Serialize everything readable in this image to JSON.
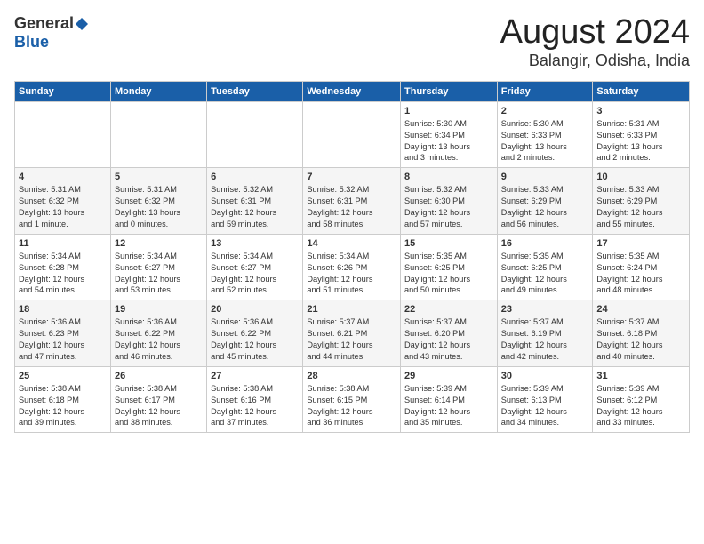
{
  "logo": {
    "general": "General",
    "blue": "Blue"
  },
  "title": "August 2024",
  "location": "Balangir, Odisha, India",
  "days_of_week": [
    "Sunday",
    "Monday",
    "Tuesday",
    "Wednesday",
    "Thursday",
    "Friday",
    "Saturday"
  ],
  "weeks": [
    [
      {
        "day": "",
        "content": ""
      },
      {
        "day": "",
        "content": ""
      },
      {
        "day": "",
        "content": ""
      },
      {
        "day": "",
        "content": ""
      },
      {
        "day": "1",
        "content": "Sunrise: 5:30 AM\nSunset: 6:34 PM\nDaylight: 13 hours\nand 3 minutes."
      },
      {
        "day": "2",
        "content": "Sunrise: 5:30 AM\nSunset: 6:33 PM\nDaylight: 13 hours\nand 2 minutes."
      },
      {
        "day": "3",
        "content": "Sunrise: 5:31 AM\nSunset: 6:33 PM\nDaylight: 13 hours\nand 2 minutes."
      }
    ],
    [
      {
        "day": "4",
        "content": "Sunrise: 5:31 AM\nSunset: 6:32 PM\nDaylight: 13 hours\nand 1 minute."
      },
      {
        "day": "5",
        "content": "Sunrise: 5:31 AM\nSunset: 6:32 PM\nDaylight: 13 hours\nand 0 minutes."
      },
      {
        "day": "6",
        "content": "Sunrise: 5:32 AM\nSunset: 6:31 PM\nDaylight: 12 hours\nand 59 minutes."
      },
      {
        "day": "7",
        "content": "Sunrise: 5:32 AM\nSunset: 6:31 PM\nDaylight: 12 hours\nand 58 minutes."
      },
      {
        "day": "8",
        "content": "Sunrise: 5:32 AM\nSunset: 6:30 PM\nDaylight: 12 hours\nand 57 minutes."
      },
      {
        "day": "9",
        "content": "Sunrise: 5:33 AM\nSunset: 6:29 PM\nDaylight: 12 hours\nand 56 minutes."
      },
      {
        "day": "10",
        "content": "Sunrise: 5:33 AM\nSunset: 6:29 PM\nDaylight: 12 hours\nand 55 minutes."
      }
    ],
    [
      {
        "day": "11",
        "content": "Sunrise: 5:34 AM\nSunset: 6:28 PM\nDaylight: 12 hours\nand 54 minutes."
      },
      {
        "day": "12",
        "content": "Sunrise: 5:34 AM\nSunset: 6:27 PM\nDaylight: 12 hours\nand 53 minutes."
      },
      {
        "day": "13",
        "content": "Sunrise: 5:34 AM\nSunset: 6:27 PM\nDaylight: 12 hours\nand 52 minutes."
      },
      {
        "day": "14",
        "content": "Sunrise: 5:34 AM\nSunset: 6:26 PM\nDaylight: 12 hours\nand 51 minutes."
      },
      {
        "day": "15",
        "content": "Sunrise: 5:35 AM\nSunset: 6:25 PM\nDaylight: 12 hours\nand 50 minutes."
      },
      {
        "day": "16",
        "content": "Sunrise: 5:35 AM\nSunset: 6:25 PM\nDaylight: 12 hours\nand 49 minutes."
      },
      {
        "day": "17",
        "content": "Sunrise: 5:35 AM\nSunset: 6:24 PM\nDaylight: 12 hours\nand 48 minutes."
      }
    ],
    [
      {
        "day": "18",
        "content": "Sunrise: 5:36 AM\nSunset: 6:23 PM\nDaylight: 12 hours\nand 47 minutes."
      },
      {
        "day": "19",
        "content": "Sunrise: 5:36 AM\nSunset: 6:22 PM\nDaylight: 12 hours\nand 46 minutes."
      },
      {
        "day": "20",
        "content": "Sunrise: 5:36 AM\nSunset: 6:22 PM\nDaylight: 12 hours\nand 45 minutes."
      },
      {
        "day": "21",
        "content": "Sunrise: 5:37 AM\nSunset: 6:21 PM\nDaylight: 12 hours\nand 44 minutes."
      },
      {
        "day": "22",
        "content": "Sunrise: 5:37 AM\nSunset: 6:20 PM\nDaylight: 12 hours\nand 43 minutes."
      },
      {
        "day": "23",
        "content": "Sunrise: 5:37 AM\nSunset: 6:19 PM\nDaylight: 12 hours\nand 42 minutes."
      },
      {
        "day": "24",
        "content": "Sunrise: 5:37 AM\nSunset: 6:18 PM\nDaylight: 12 hours\nand 40 minutes."
      }
    ],
    [
      {
        "day": "25",
        "content": "Sunrise: 5:38 AM\nSunset: 6:18 PM\nDaylight: 12 hours\nand 39 minutes."
      },
      {
        "day": "26",
        "content": "Sunrise: 5:38 AM\nSunset: 6:17 PM\nDaylight: 12 hours\nand 38 minutes."
      },
      {
        "day": "27",
        "content": "Sunrise: 5:38 AM\nSunset: 6:16 PM\nDaylight: 12 hours\nand 37 minutes."
      },
      {
        "day": "28",
        "content": "Sunrise: 5:38 AM\nSunset: 6:15 PM\nDaylight: 12 hours\nand 36 minutes."
      },
      {
        "day": "29",
        "content": "Sunrise: 5:39 AM\nSunset: 6:14 PM\nDaylight: 12 hours\nand 35 minutes."
      },
      {
        "day": "30",
        "content": "Sunrise: 5:39 AM\nSunset: 6:13 PM\nDaylight: 12 hours\nand 34 minutes."
      },
      {
        "day": "31",
        "content": "Sunrise: 5:39 AM\nSunset: 6:12 PM\nDaylight: 12 hours\nand 33 minutes."
      }
    ]
  ]
}
